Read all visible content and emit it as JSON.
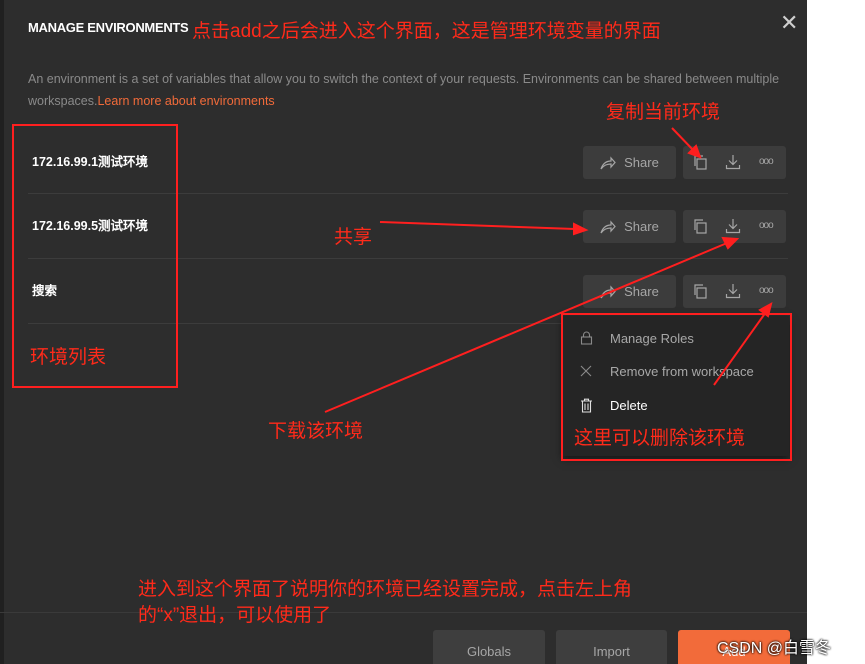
{
  "modal": {
    "title": "MANAGE ENVIRONMENTS",
    "close_glyph": "✕",
    "description": "An environment is a set of variables that allow you to switch the context of your requests. Environments can be shared between multiple workspaces.",
    "learn_more": "Learn more about environments"
  },
  "environments": [
    {
      "name": "172.16.99.1测试环境",
      "share_label": "Share"
    },
    {
      "name": "172.16.99.5测试环境",
      "share_label": "Share"
    },
    {
      "name": "搜索",
      "share_label": "Share"
    }
  ],
  "icons": {
    "share": "share-arrow-icon",
    "duplicate": "copy-icon",
    "download": "download-icon",
    "more": "more-dots-icon",
    "manage_roles": "lock-icon",
    "remove": "close-icon",
    "delete": "trash-icon"
  },
  "menu": {
    "items": [
      {
        "label": "Manage Roles"
      },
      {
        "label": "Remove from workspace"
      },
      {
        "label": "Delete"
      }
    ]
  },
  "footer": {
    "globals": "Globals",
    "import": "Import",
    "add": "Add"
  },
  "watermark": "CSDN @白雪冬",
  "annotations": {
    "title_note": "点击add之后会进入这个界面，这是管理环境变量的界面",
    "copy_note": "复制当前环境",
    "share_note": "共享",
    "list_note": "环境列表",
    "download_note": "下载该环境",
    "delete_note": "这里可以删除该环境",
    "bottom_line1": "进入到这个界面了说明你的环境已经设置完成，点击左上角",
    "bottom_line2": "的“x”退出，可以使用了"
  },
  "colors": {
    "background": "#2d2d2d",
    "accent": "#f26b3a",
    "annotation": "#ff2a1a"
  }
}
